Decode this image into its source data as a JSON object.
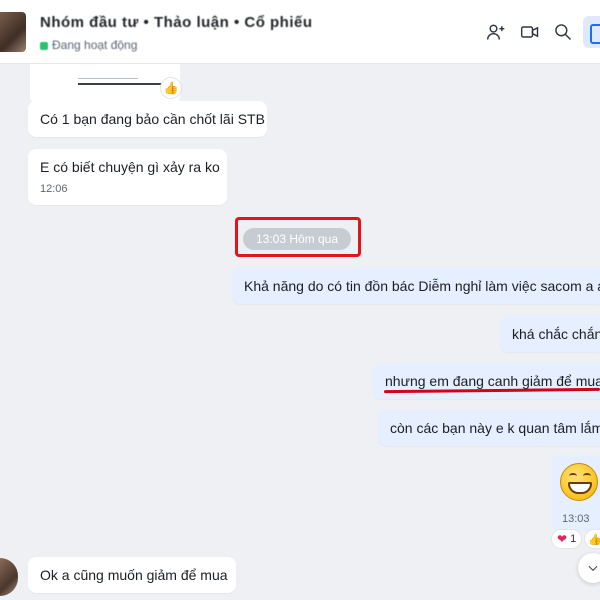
{
  "header": {
    "title": "Nhóm đầu tư • Thảo luận • Cổ phiếu",
    "subtitle": "Đang hoạt động",
    "icons": [
      "add-member-icon",
      "video-call-icon",
      "search-icon",
      "side-panel-icon"
    ]
  },
  "prev_card": {
    "reaction_icon": "thumbs-up-icon"
  },
  "messages": {
    "m1": {
      "text": "Có 1 bạn đang bảo cần chốt lãi STB"
    },
    "m2": {
      "text": "E có biết chuyện gì xảy ra ko",
      "time": "12:06"
    },
    "divider": {
      "label": "13:03 Hôm qua"
    },
    "m3": {
      "text": "Khả năng do có tin đồn bác Diễm nghỉ làm việc sacom a ạ"
    },
    "m4": {
      "text": "khá chắc chắn"
    },
    "m5": {
      "text": "nhưng em đang canh giảm để mua"
    },
    "m6": {
      "text": "còn các bạn này e k quan tâm lắm"
    },
    "m7": {
      "emoji": "grinning-face",
      "time": "13:03",
      "reaction_count": "1",
      "reaction": "heart"
    },
    "m8": {
      "text": "Ok a cũng muốn giảm để mua"
    }
  },
  "colors": {
    "accent": "#1a6ff2",
    "annotation_red": "#e3141b",
    "outgoing_bg": "#e5efff",
    "chat_bg": "#eef0f3"
  }
}
